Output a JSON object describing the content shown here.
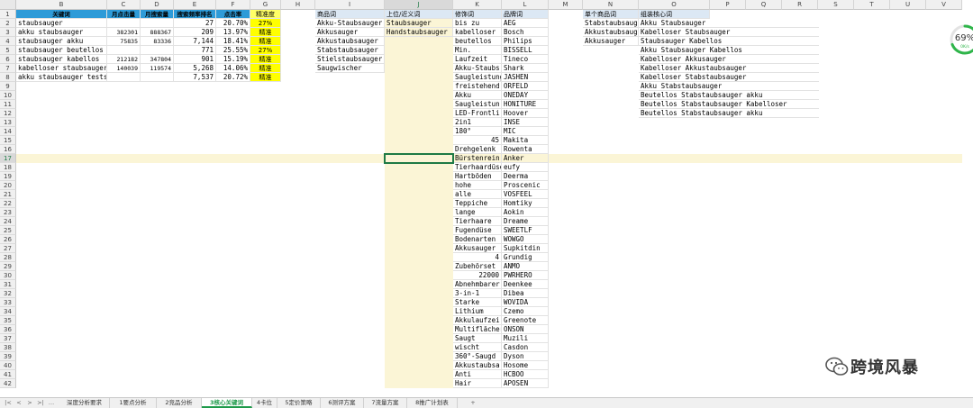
{
  "columns": [
    {
      "letter": "B"
    },
    {
      "letter": "C"
    },
    {
      "letter": "D"
    },
    {
      "letter": "E"
    },
    {
      "letter": "F"
    },
    {
      "letter": "G"
    },
    {
      "letter": "H"
    },
    {
      "letter": "I"
    },
    {
      "letter": "J"
    },
    {
      "letter": "K"
    },
    {
      "letter": "L"
    },
    {
      "letter": "M"
    },
    {
      "letter": "N"
    },
    {
      "letter": "O"
    },
    {
      "letter": "P"
    },
    {
      "letter": "Q"
    },
    {
      "letter": "R"
    },
    {
      "letter": "S"
    },
    {
      "letter": "T"
    },
    {
      "letter": "U"
    },
    {
      "letter": "V"
    }
  ],
  "selected_column": "J",
  "selected_row": 17,
  "headers": {
    "B": "关键词",
    "C": "月点击量",
    "D": "月搜索量",
    "E": "搜索频率排名",
    "F": "点击率",
    "G": "精准度",
    "I": "商品词",
    "J": "上位/近义词",
    "K": "修饰词",
    "L": "品牌词",
    "N": "单个商品词",
    "O": "组装核心词"
  },
  "keyword_table": [
    {
      "keyword": "staubsauger",
      "clicks": "",
      "searches": "",
      "rank": "27",
      "ctr": "20.70%",
      "precision": "27%"
    },
    {
      "keyword": "akku staubsauger",
      "clicks": "382301",
      "searches": "888367",
      "rank": "209",
      "ctr": "13.97%",
      "precision": "精准"
    },
    {
      "keyword": "staubsauger akku",
      "clicks": "75835",
      "searches": "83336",
      "rank": "7,144",
      "ctr": "18.41%",
      "precision": "精准"
    },
    {
      "keyword": "staubsauger beutellos",
      "clicks": "",
      "searches": "",
      "rank": "771",
      "ctr": "25.55%",
      "precision": "27%"
    },
    {
      "keyword": "staubsauger kabellos",
      "clicks": "212182",
      "searches": "347804",
      "rank": "901",
      "ctr": "15.19%",
      "precision": "精准"
    },
    {
      "keyword": "kabelloser staubsauger",
      "clicks": "140039",
      "searches": "119574",
      "rank": "5,268",
      "ctr": "14.06%",
      "precision": "精准"
    },
    {
      "keyword": "akku staubsauger tests",
      "clicks": "",
      "searches": "",
      "rank": "7,537",
      "ctr": "20.72%",
      "precision": "精准"
    }
  ],
  "product_words": [
    "Akku-Staubsauger",
    "Akkusauger",
    "Akkustaubsauger",
    "Stabstaubsauger",
    "Stielstaubsauger",
    "Saugwischer"
  ],
  "synonyms": [
    "Staubsauger",
    "Handstaubsauger"
  ],
  "modifiers": [
    "bis zu",
    "kabelloser",
    "beutellos",
    "Min.",
    "Laufzeit",
    "Akku-Staubs",
    "Saugleistung",
    "freistehend",
    "Akku",
    "Saugleistun",
    "LED-Frontli",
    "2in1",
    "180°",
    "45",
    "Drehgelenk",
    "Bürstenrein",
    "Tierhaardüse",
    "Hartböden",
    "hohe",
    "alle",
    "Teppiche",
    "lange",
    "Tierhaare",
    "Fugendüse",
    "Bodenarten",
    "Akkusauger",
    "4",
    "Zubehörset",
    "22000",
    "Abnehmbarer",
    "3-in-1",
    "Starke",
    "Lithium",
    "Akkulaufzei",
    "Multiflächer",
    "Saugt",
    "wischt",
    "360°-Saugd",
    "Akkustaubsa",
    "Anti",
    "Hair"
  ],
  "brands": [
    "AEG",
    "Bosch",
    "Philips",
    "BISSELL",
    "Tineco",
    "Shark",
    "JASHEN",
    "ORFELD",
    "ONEDAY",
    "HONITURE",
    "Hoover",
    "INSE",
    "MIC",
    "Makita",
    "Rowenta",
    "Anker",
    "eufy",
    "Deerma",
    "Proscenic",
    "VOSFEEL",
    "Homtiky",
    "Aokin",
    "Dreame",
    "SWEETLF",
    "WOWGO",
    "Supkitdin",
    "Grundig",
    "ANMO",
    "PWRHERO",
    "Deenkee",
    "Dibea",
    "WOVIDA",
    "Czemo",
    "Greenote",
    "ONSON",
    "Muzili",
    "Casdon",
    "Dyson",
    "Hosome",
    "HCBOO",
    "APOSEN"
  ],
  "single_product": [
    "Stabstaubsauger",
    "Akkustaubsauger",
    "Akkusauger"
  ],
  "core_words": [
    "Akku Staubsauger",
    "Kabelloser Staubsauger",
    "Staubsauger Kabellos",
    "Akku Staubsauger Kabellos",
    "Kabelloser Akkusauger",
    "Kabelloser Akkustaubsauger",
    "Kabelloser Stabstaubsauger",
    "Akku Stabstaubsauger",
    "Beutellos Stabstaubsauger akku",
    "Beutellos Stabstaubsauger Kabelloser",
    "Beutellos Stabstaubsauger akku"
  ],
  "sheet_tabs": [
    {
      "label": "深度分析要求"
    },
    {
      "label": "1要点分析"
    },
    {
      "label": "2竞品分析"
    },
    {
      "label": "3核心关键词",
      "active": true
    },
    {
      "label": "4卡位"
    },
    {
      "label": "5定价策略"
    },
    {
      "label": "6测评方案"
    },
    {
      "label": "7流量方案"
    },
    {
      "label": "8推广计划表"
    }
  ],
  "gauge": {
    "percent": "69%",
    "speed": "0K/s",
    "value": 0.69,
    "color": "#2fb54a"
  },
  "watermark": {
    "text": "跨境风暴"
  },
  "colors": {
    "header_blue": "#2e9bd8",
    "highlight_yellow": "#ffff00",
    "active_green": "#1e7a45"
  }
}
